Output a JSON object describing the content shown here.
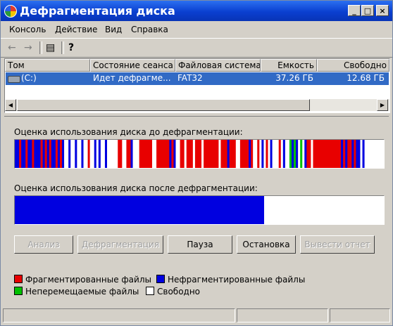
{
  "window": {
    "title": "Дефрагментация диска",
    "minimize": "_",
    "maximize": "□",
    "close": "×"
  },
  "menu": [
    "Консоль",
    "Действие",
    "Вид",
    "Справка"
  ],
  "toolbar": {
    "back": "←",
    "forward": "→",
    "properties": "▤",
    "help": "?"
  },
  "table": {
    "headers": [
      "Том",
      "Состояние сеанса",
      "Файловая система",
      "Емкость",
      "Свободно"
    ],
    "rows": [
      {
        "volume": "(C:)",
        "status": "Идет дефрагме...",
        "fs": "FAT32",
        "capacity": "37.26 ГБ",
        "free": "12.68 ГБ"
      }
    ]
  },
  "before_label": "Оценка использования диска до дефрагментации:",
  "after_label": "Оценка использования диска после дефрагментации:",
  "buttons": {
    "analyze": "Анализ",
    "defrag": "Дефрагментация",
    "pause": "Пауза",
    "stop": "Остановка",
    "report": "Вывести отчет"
  },
  "legend": {
    "fragmented": "Фрагментированные файлы",
    "contiguous": "Нефрагментированные файлы",
    "unmovable": "Неперемещаемые файлы",
    "free": "Свободно"
  },
  "colors": {
    "fragmented": "#e80000",
    "contiguous": "#0000e0",
    "unmovable": "#00c000",
    "free": "#ffffff"
  },
  "after_usage_fraction": 0.675,
  "before_map": [
    [
      "B",
      0,
      2
    ],
    [
      "R",
      2,
      3
    ],
    [
      "B",
      3,
      5
    ],
    [
      "R",
      5,
      6
    ],
    [
      "B",
      6,
      8
    ],
    [
      "R",
      8,
      9
    ],
    [
      "B",
      9,
      12
    ],
    [
      "R",
      12,
      13
    ],
    [
      "B",
      13,
      14
    ],
    [
      "R",
      14,
      15
    ],
    [
      "B",
      15,
      16
    ],
    [
      "R",
      16,
      17
    ],
    [
      "B",
      17,
      19
    ],
    [
      "R",
      19,
      20
    ],
    [
      "B",
      20,
      21
    ],
    [
      "R",
      21,
      22
    ],
    [
      "B",
      22,
      23
    ],
    [
      "W",
      23,
      25
    ],
    [
      "B",
      25,
      26
    ],
    [
      "W",
      26,
      28
    ],
    [
      "B",
      28,
      29
    ],
    [
      "W",
      29,
      31
    ],
    [
      "B",
      31,
      32
    ],
    [
      "W",
      32,
      34
    ],
    [
      "R",
      34,
      35
    ],
    [
      "W",
      35,
      37
    ],
    [
      "B",
      37,
      38
    ],
    [
      "W",
      38,
      39
    ],
    [
      "B",
      39,
      40
    ],
    [
      "W",
      40,
      42
    ],
    [
      "B",
      42,
      43
    ],
    [
      "W",
      43,
      48
    ],
    [
      "R",
      48,
      50
    ],
    [
      "W",
      50,
      52
    ],
    [
      "R",
      52,
      54
    ],
    [
      "B",
      54,
      55
    ],
    [
      "W",
      55,
      58
    ],
    [
      "R",
      58,
      64
    ],
    [
      "W",
      64,
      66
    ],
    [
      "R",
      66,
      72
    ],
    [
      "B",
      72,
      73
    ],
    [
      "R",
      73,
      74
    ],
    [
      "B",
      74,
      75
    ],
    [
      "W",
      75,
      77
    ],
    [
      "R",
      77,
      79
    ],
    [
      "W",
      79,
      80
    ],
    [
      "R",
      80,
      83
    ],
    [
      "W",
      83,
      84
    ],
    [
      "R",
      84,
      87
    ],
    [
      "W",
      87,
      88
    ],
    [
      "R",
      88,
      95
    ],
    [
      "W",
      95,
      96
    ],
    [
      "R",
      96,
      99
    ],
    [
      "B",
      99,
      100
    ],
    [
      "R",
      100,
      103
    ],
    [
      "W",
      103,
      105
    ],
    [
      "R",
      105,
      109
    ],
    [
      "B",
      109,
      110
    ],
    [
      "R",
      110,
      111
    ],
    [
      "W",
      111,
      113
    ],
    [
      "R",
      113,
      114
    ],
    [
      "W",
      114,
      115
    ],
    [
      "B",
      115,
      116
    ],
    [
      "W",
      116,
      117
    ],
    [
      "R",
      117,
      118
    ],
    [
      "W",
      118,
      119
    ],
    [
      "B",
      119,
      120
    ],
    [
      "W",
      120,
      123
    ],
    [
      "R",
      123,
      124
    ],
    [
      "W",
      124,
      125
    ],
    [
      "B",
      125,
      126
    ],
    [
      "W",
      126,
      128
    ],
    [
      "G",
      128,
      129
    ],
    [
      "B",
      129,
      130
    ],
    [
      "G",
      130,
      131
    ],
    [
      "B",
      131,
      132
    ],
    [
      "W",
      132,
      133
    ],
    [
      "G",
      133,
      134
    ],
    [
      "W",
      134,
      135
    ],
    [
      "B",
      135,
      136
    ],
    [
      "R",
      136,
      138
    ],
    [
      "W",
      138,
      139
    ],
    [
      "R",
      139,
      152
    ],
    [
      "B",
      152,
      153
    ],
    [
      "R",
      153,
      154
    ],
    [
      "B",
      154,
      155
    ],
    [
      "R",
      155,
      157
    ],
    [
      "B",
      157,
      158
    ],
    [
      "R",
      158,
      159
    ],
    [
      "B",
      159,
      161
    ],
    [
      "W",
      161,
      162
    ],
    [
      "B",
      162,
      163
    ],
    [
      "W",
      163,
      172
    ]
  ]
}
